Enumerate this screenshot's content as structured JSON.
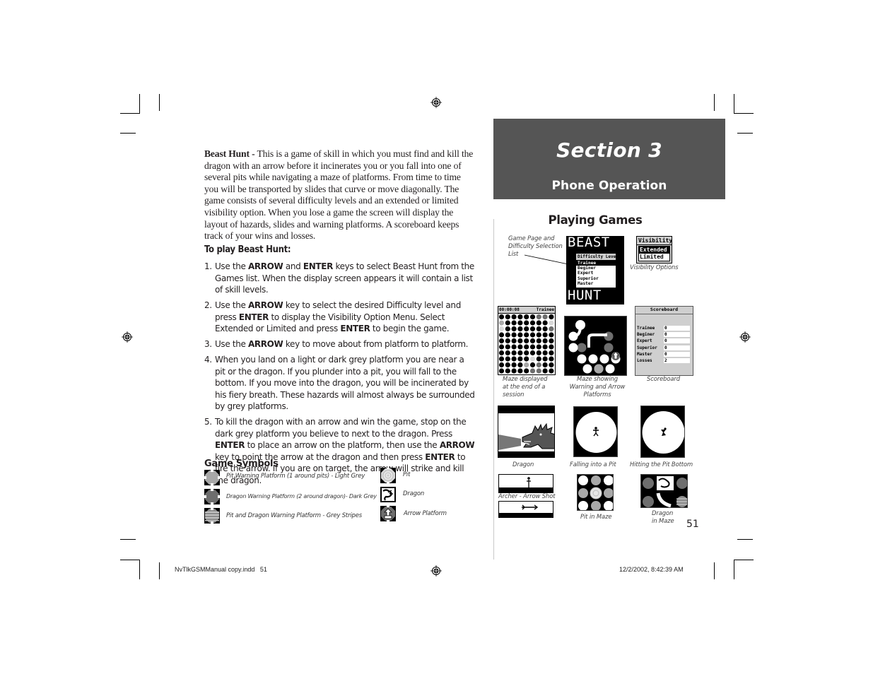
{
  "left_column": {
    "intro_title": "Beast Hunt -",
    "intro_text": " This is a game of skill in which you must find and kill the dragon with an arrow before it incinerates you or you fall into one of several pits while navigating a maze of platforms.  From time to time you will be transported by slides that curve or move diagonally.  The game consists of several difficulty levels and an extended or limited visibility option.  When you lose a game the screen will display the layout of hazards, slides and warning platforms.  A scoreboard keeps track of your wins and losses.",
    "how_to_heading": "To play Beast Hunt:",
    "steps": [
      {
        "num": "1.",
        "parts": [
          "Use the ",
          "ARROW",
          " and ",
          "ENTER",
          " keys to select Beast Hunt from the Games list.  When the display screen appears it will contain a list of skill levels."
        ]
      },
      {
        "num": "2.",
        "parts": [
          "Use the ",
          "ARROW",
          " key to select the desired Difficulty level and press ",
          "ENTER",
          " to display the Visibility Option Menu. Select Extended or Limited and press ",
          "ENTER",
          " to begin the game."
        ]
      },
      {
        "num": "3.",
        "parts": [
          "Use the ",
          "ARROW",
          " key to move about from platform to platform."
        ]
      },
      {
        "num": "4.",
        "parts": [
          "When you land on a light or dark grey platform you are near a pit or the dragon. If you plunder into a pit, you will fall to the bottom. If you move into the dragon, you will be incinerated by his fiery breath. These hazards will almost always be surrounded by grey platforms."
        ]
      },
      {
        "num": "5.",
        "parts": [
          "To kill the dragon with an arrow and win the game, stop on the dark grey platform you believe to next to the dragon.  Press ",
          "ENTER",
          " to place an arrow on the platform, then use the ",
          "ARROW",
          " key to point the arrow at the dragon and then press ",
          "ENTER",
          " to fire the arrow. If you are on target, the arrow will strike and kill the dragon."
        ]
      }
    ],
    "symbols_heading": "Game Symbols",
    "symbols": [
      {
        "icon": "pit-warning-platform-icon",
        "label": "Pit Warning Platform (1 around pits) -  Light Grey",
        "color": "#a8a8a8"
      },
      {
        "icon": "dragon-warning-platform-icon",
        "label": "Dragon Warning Platform (2 around dragon)- Dark Grey",
        "color": "#6e6e6e"
      },
      {
        "icon": "pit-dragon-warning-platform-icon",
        "label": "Pit and Dragon Warning Platform - Grey Stripes",
        "color": "#8c8c8c"
      },
      {
        "icon": "pit-icon",
        "label": "Pit"
      },
      {
        "icon": "dragon-icon",
        "label": "Dragon"
      },
      {
        "icon": "arrow-platform-icon",
        "label": "Arrow Platform"
      }
    ]
  },
  "right_column": {
    "section_title": "Section 3",
    "section_subtitle": "Phone Operation",
    "section_bg": "#555555",
    "heading": "Playing Games",
    "figures": {
      "game_page": {
        "caption": "Game Page and Difficulty Selection List",
        "title_top": "BEAST",
        "title_bottom": "HUNT",
        "menu_title": "Difficulty Level",
        "menu_items": [
          "Trainee",
          "Beginer",
          "Expert",
          "Superior",
          "Master"
        ],
        "selected": "Trainee"
      },
      "visibility": {
        "caption": "Visibility Options",
        "title": "Visibility",
        "options": [
          "Extended",
          "Limited"
        ],
        "selected": "Extended"
      },
      "maze_end": {
        "caption": "Maze displayed at the end of a session",
        "timer": "00:00:08",
        "level": "Trainee"
      },
      "maze_warning": {
        "caption": "Maze showing Warning and Arrow Platforms"
      },
      "scoreboard": {
        "caption": "Scoreboard",
        "title": "Scoreboard",
        "rows": [
          {
            "label": "Trainee",
            "value": "0"
          },
          {
            "label": "Beginer",
            "value": "0"
          },
          {
            "label": "Expert",
            "value": "0"
          },
          {
            "label": "Superior",
            "value": "0"
          },
          {
            "label": "Master",
            "value": "0"
          },
          {
            "label": "Losses",
            "value": "2"
          }
        ]
      },
      "dragon": {
        "caption": "Dragon"
      },
      "falling": {
        "caption": "Falling into a Pit"
      },
      "pit_bottom": {
        "caption": "Hitting the Pit Bottom"
      },
      "archer": {
        "caption": "Archer - Arrow Shot"
      },
      "pit_maze": {
        "caption": "Pit in Maze"
      },
      "dragon_maze": {
        "caption": "Dragon in Maze"
      }
    },
    "page_number": "51"
  },
  "footer": {
    "file": "NvTlkGSMManual copy.indd   51",
    "timestamp": "12/2/2002, 8:42:39 AM"
  }
}
